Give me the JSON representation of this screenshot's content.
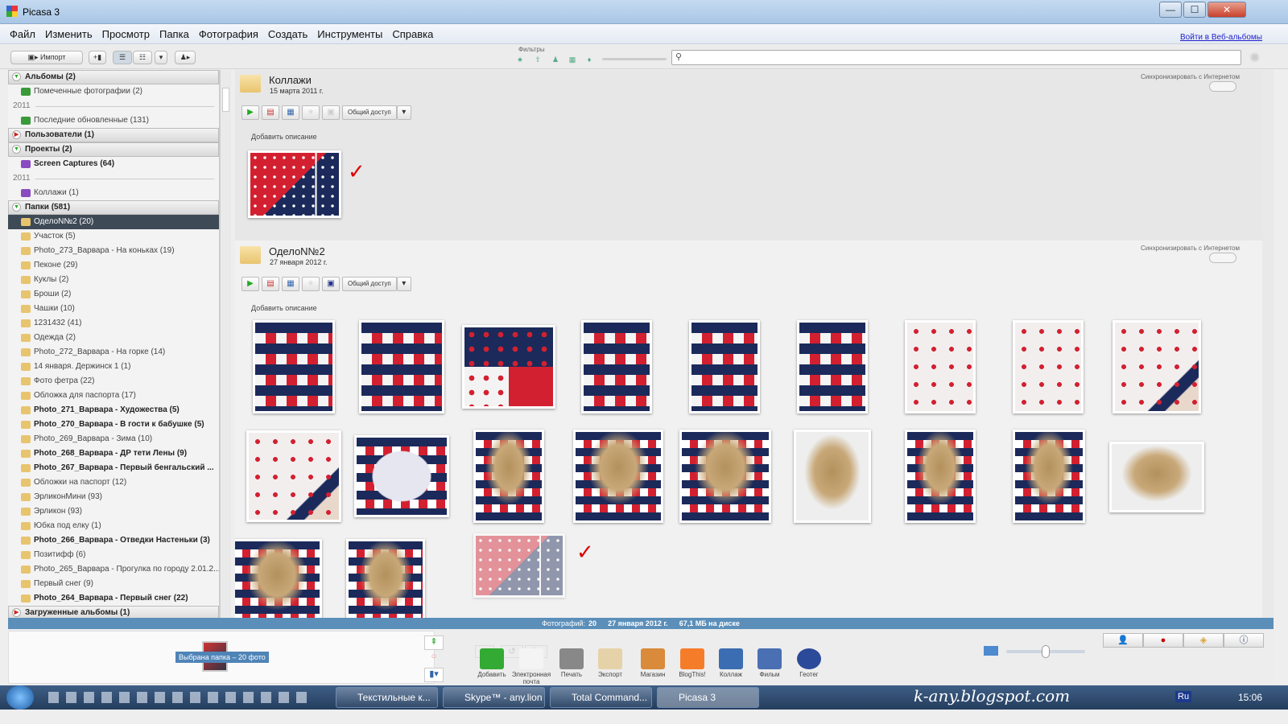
{
  "window": {
    "title": "Picasa 3",
    "minimize": "—",
    "maximize": "☐",
    "close": "✕"
  },
  "menu": [
    "Файл",
    "Изменить",
    "Просмотр",
    "Папка",
    "Фотография",
    "Создать",
    "Инструменты",
    "Справка"
  ],
  "web_albums_link": "Войти в Веб-альбомы",
  "toolbar": {
    "import_label": "Импорт",
    "filters_label": "Фильтры",
    "search_placeholder": ""
  },
  "sidebar": {
    "sections": [
      {
        "label": "Альбомы (2)",
        "expanded": true,
        "items": [
          {
            "label": "Помеченные фотографии (2)"
          },
          {
            "year": "2011"
          },
          {
            "label": "Последние обновленные (131)"
          }
        ]
      },
      {
        "label": "Пользователи (1)",
        "expanded": false,
        "items": []
      },
      {
        "label": "Проекты (2)",
        "expanded": true,
        "items": [
          {
            "label": "Screen Captures (64)",
            "bold": true
          },
          {
            "year": "2011"
          },
          {
            "label": "Коллажи (1)"
          }
        ]
      },
      {
        "label": "Папки (581)",
        "expanded": true,
        "items": [
          {
            "label": "ОделоN№2 (20)",
            "selected": true
          },
          {
            "label": "Участок (5)"
          },
          {
            "label": "Photo_273_Варвара - На коньках (19)"
          },
          {
            "label": "Пеконе (29)"
          },
          {
            "label": "Куклы (2)"
          },
          {
            "label": "Броши (2)"
          },
          {
            "label": "Чашки (10)"
          },
          {
            "label": "1231432 (41)"
          },
          {
            "label": "Одежда (2)"
          },
          {
            "label": "Photo_272_Варвара - На горке (14)"
          },
          {
            "label": "14 января. Держинск 1 (1)"
          },
          {
            "label": "Фото фетра (22)"
          },
          {
            "label": "Обложка для паспорта (17)"
          },
          {
            "label": "Photo_271_Варвара - Художества (5)",
            "bold": true
          },
          {
            "label": "Photo_270_Варвара - В гости к бабушке (5)",
            "bold": true
          },
          {
            "label": "Photo_269_Варвара - Зима (10)"
          },
          {
            "label": "Photo_268_Варвара - ДР тети Лены (9)",
            "bold": true
          },
          {
            "label": "Photo_267_Варвара - Первый бенгальский ...",
            "bold": true
          },
          {
            "label": "Обложки на паспорт (12)"
          },
          {
            "label": "ЭрликонМини (93)"
          },
          {
            "label": "Эрликон (93)"
          },
          {
            "label": "Юбка под елку (1)"
          },
          {
            "label": "Photo_266_Варвара - Отведки Настеньки (3)",
            "bold": true
          },
          {
            "label": "Позитифф (6)"
          },
          {
            "label": "Photo_265_Варвара - Прогулка по городу 2.01.2..."
          },
          {
            "label": "Первый снег (9)"
          },
          {
            "label": "Photo_264_Варвара - Первый снег (22)",
            "bold": true
          }
        ]
      },
      {
        "label": "Загруженные альбомы (1)",
        "expanded": false,
        "items": []
      }
    ]
  },
  "albums": [
    {
      "name": "Коллажи",
      "date": "15 марта 2011 г.",
      "sync": "Синхронизировать с Интернетом",
      "share": "Общий доступ",
      "add_description": "Добавить описание",
      "photo_count": 1
    },
    {
      "name": "ОделоN№2",
      "date": "27 января 2012 г.",
      "sync": "Синхронизировать с Интернетом",
      "share": "Общий доступ",
      "add_description": "Добавить описание",
      "photo_count": 21
    }
  ],
  "status": {
    "photos_label": "Фотографий:",
    "photos": "20",
    "date": "27 января 2012 г.",
    "size": "67,1 МБ на диске"
  },
  "tray": {
    "selection": "Выбрана папка – 20 фото"
  },
  "actions": [
    "Добавить",
    "Электронная почта",
    "Печать",
    "Экспорт",
    "Магазин",
    "BlogThis!",
    "Коллаж",
    "Фильм",
    "Геотег"
  ],
  "taskbar": {
    "tasks": [
      "Текстильные к...",
      "Skype™ - any.lion",
      "Total Command...",
      "Picasa 3"
    ],
    "watermark": "k-any.blogspot.com",
    "lang": "Ru",
    "clock": "15:06"
  },
  "colors": {
    "status_bar": "#5b8fba",
    "selected_item": "#3e4a56",
    "quilt_navy": "#1b2a5a",
    "quilt_red": "#d32030"
  }
}
